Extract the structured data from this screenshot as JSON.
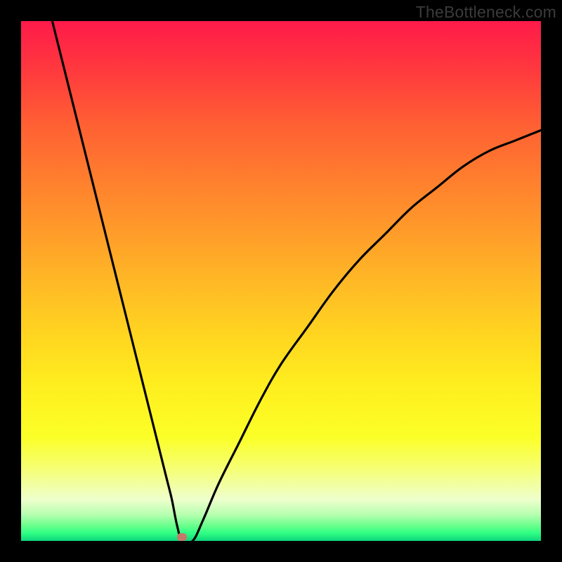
{
  "watermark": "TheBottleneck.com",
  "chart_data": {
    "type": "line",
    "title": "",
    "xlabel": "",
    "ylabel": "",
    "xlim": [
      0,
      100
    ],
    "ylim": [
      0,
      100
    ],
    "grid": false,
    "axes_visible": false,
    "background": "rainbow-gradient-vertical",
    "series": [
      {
        "name": "bottleneck-curve",
        "color": "#000000",
        "x": [
          6,
          8,
          10,
          12,
          14,
          16,
          18,
          20,
          22,
          24,
          26,
          28,
          29,
          30,
          31,
          33,
          35,
          38,
          42,
          46,
          50,
          55,
          60,
          65,
          70,
          75,
          80,
          85,
          90,
          95,
          100
        ],
        "y": [
          100,
          92,
          84,
          76,
          68,
          60,
          52,
          44,
          36,
          28,
          20,
          12,
          8,
          3,
          0,
          0,
          4,
          11,
          19,
          27,
          34,
          41,
          48,
          54,
          59,
          64,
          68,
          72,
          75,
          77,
          79
        ]
      }
    ],
    "marker": {
      "x": 31,
      "color": "#c5786b"
    }
  }
}
